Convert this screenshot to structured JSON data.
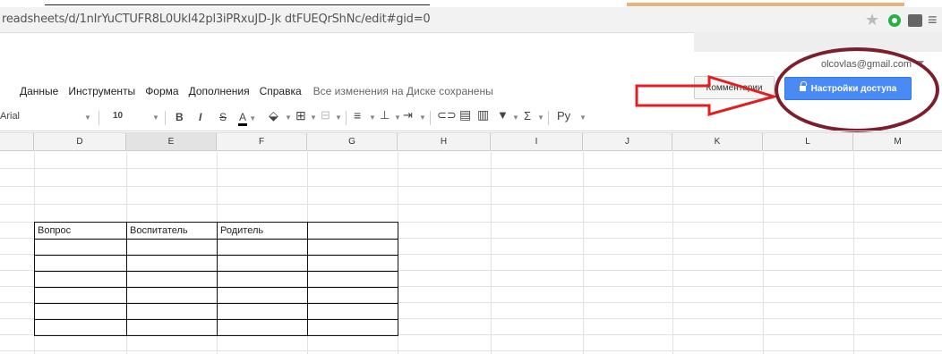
{
  "browser": {
    "url": "readsheets/d/1nIrYuCTUFR8L0UkI42pl3iPRxuJD-Jk dtFUEQrShNc/edit#gid=0"
  },
  "account": {
    "email": "olcovlas@gmail.com"
  },
  "buttons": {
    "comments": "Комментарии",
    "share": "Настройки доступа"
  },
  "menu": {
    "items": [
      "Данные",
      "Инструменты",
      "Форма",
      "Дополнения",
      "Справка"
    ],
    "status": "Все изменения на Диске сохранены"
  },
  "toolbar": {
    "font": "Arial",
    "size": "10",
    "bold": "B",
    "italic": "I",
    "strike": "S",
    "text_color": "A",
    "sum": "Σ",
    "input_tools": "Ру"
  },
  "columns": [
    "D",
    "E",
    "F",
    "G",
    "H",
    "I",
    "J",
    "K",
    "L",
    "M"
  ],
  "table": {
    "header": [
      "Вопрос",
      "Воспитатель",
      "Родитель",
      ""
    ],
    "empty_rows": 6
  },
  "colors": {
    "share_button": "#4a8af4",
    "annotation_ellipse": "#7c1f2d",
    "annotation_arrow": "#e02020"
  }
}
